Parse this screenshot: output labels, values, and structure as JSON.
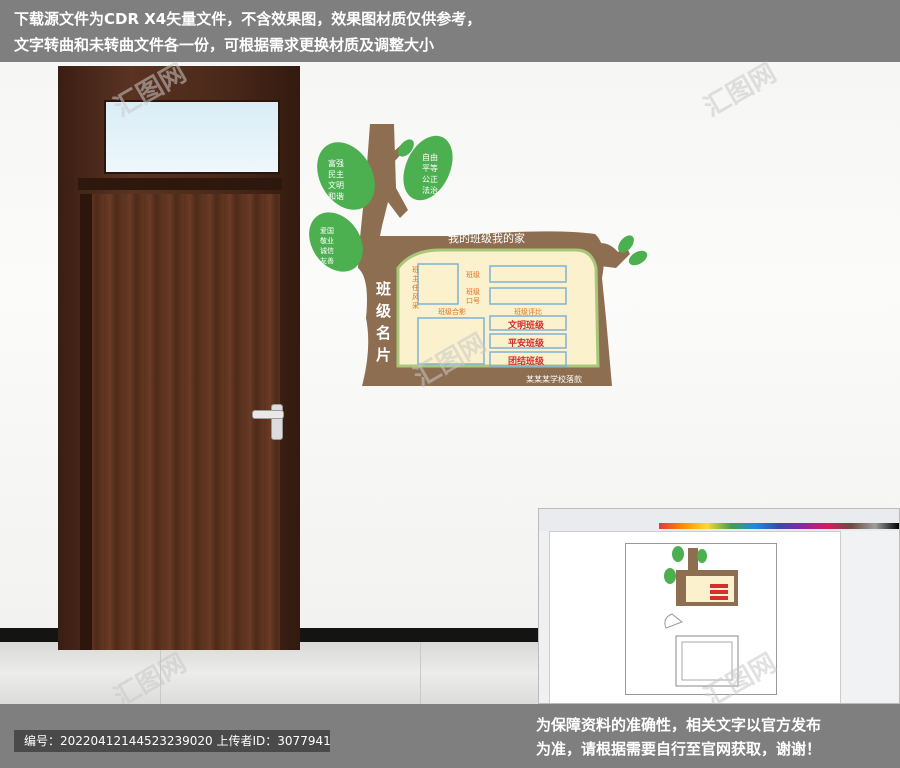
{
  "top_banner": {
    "line1": "下载源文件为CDR X4矢量文件，不含效果图，效果图材质仅供参考，",
    "line2": "文字转曲和未转曲文件各一份，可根据需求更换材质及调整大小"
  },
  "board": {
    "header": "我的班级我的家",
    "title_vertical": [
      "班",
      "级",
      "名",
      "片"
    ],
    "leaf_left_top": [
      "富强",
      "民主",
      "文明",
      "和谐"
    ],
    "leaf_right_top": [
      "自由",
      "平等",
      "公正",
      "法治"
    ],
    "leaf_left_bottom": [
      "爱国",
      "敬业",
      "诚信",
      "友善"
    ],
    "teacher_photo_label": [
      "班",
      "主",
      "任",
      "风",
      "采"
    ],
    "class_label": "班级",
    "slogan_label": [
      "班级",
      "口号"
    ],
    "group_photo_label": "班级合影",
    "evaluation_label": "班级评比",
    "awards": [
      "文明班级",
      "平安班级",
      "团结班级"
    ],
    "footer": "某某某学校落款"
  },
  "bottom_banner": {
    "id_line": "编号：20220412144523239020 上传者ID：3077941",
    "notice_line1": "为保障资料的准确性，相关文字以官方发布",
    "notice_line2": "为准，请根据需要自行至官网获取，谢谢！"
  },
  "watermark_text": "汇图网",
  "colors": {
    "banner_gray": "#7f7f7f",
    "board_brown": "#8d6e50",
    "leaf_green": "#4caf50",
    "cream": "#fbf1cc",
    "award_red": "#d32f2f"
  }
}
